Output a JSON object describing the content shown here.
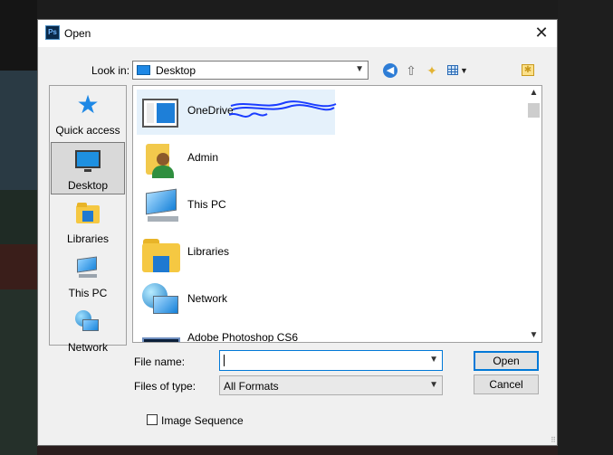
{
  "dialog": {
    "title": "Open",
    "app_icon_text": "Ps",
    "close_glyph": "✕"
  },
  "toolbar": {
    "look_in_label": "Look in:",
    "look_in_value": "Desktop",
    "icons": [
      "back-arrow-icon",
      "up-one-level-icon",
      "new-folder-icon",
      "view-menu-icon",
      "favorite-folder-icon"
    ]
  },
  "places": [
    {
      "label": "Quick access"
    },
    {
      "label": "Desktop",
      "selected": true
    },
    {
      "label": "Libraries"
    },
    {
      "label": "This PC"
    },
    {
      "label": "Network"
    }
  ],
  "files": [
    {
      "name": "OneDrive",
      "selected": true,
      "redacted": true
    },
    {
      "name": "Admin"
    },
    {
      "name": "This PC"
    },
    {
      "name": "Libraries"
    },
    {
      "name": "Network"
    },
    {
      "name": "Adobe Photoshop CS6"
    }
  ],
  "fields": {
    "file_name_label": "File name:",
    "file_name_value": "",
    "file_type_label": "Files of type:",
    "file_type_value": "All Formats"
  },
  "buttons": {
    "open": "Open",
    "cancel": "Cancel"
  },
  "options": {
    "image_sequence_label": "Image Sequence",
    "image_sequence_checked": false
  },
  "colors": {
    "accent": "#0078d7",
    "selection": "#e5f1fb",
    "scribble": "#1a3cff"
  }
}
